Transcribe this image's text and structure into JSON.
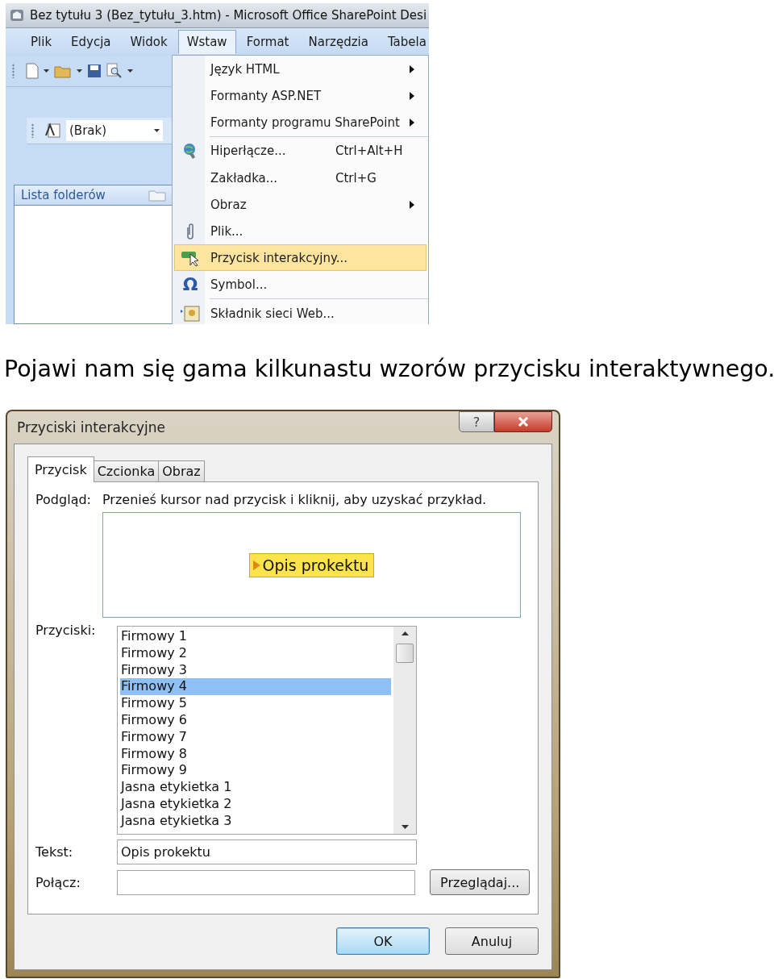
{
  "editor_window": {
    "title": "Bez tytułu 3 (Bez_tytułu_3.htm) - Microsoft Office SharePoint Desi",
    "menu_bar": [
      {
        "label": "Plik",
        "selected": false
      },
      {
        "label": "Edycja",
        "selected": false
      },
      {
        "label": "Widok",
        "selected": false
      },
      {
        "label": "Wstaw",
        "selected": true
      },
      {
        "label": "Format",
        "selected": false
      },
      {
        "label": "Narzędzia",
        "selected": false
      },
      {
        "label": "Tabela",
        "selected": false
      }
    ],
    "style_dropdown": {
      "value": "(Brak)"
    },
    "folder_list": {
      "title": "Lista folderów"
    },
    "insert_menu": [
      {
        "kind": "item",
        "label": "Język HTML",
        "submenu": true,
        "selected": false
      },
      {
        "kind": "item",
        "label": "Formanty ASP.NET",
        "submenu": true,
        "selected": false
      },
      {
        "kind": "item",
        "label": "Formanty programu SharePoint",
        "submenu": true,
        "selected": false
      },
      {
        "kind": "separator"
      },
      {
        "kind": "item",
        "label": "Hiperłącze...",
        "shortcut": "Ctrl+Alt+H",
        "submenu": false,
        "selected": false
      },
      {
        "kind": "item",
        "label": "Zakładka...",
        "shortcut": "Ctrl+G",
        "submenu": false,
        "selected": false
      },
      {
        "kind": "item",
        "label": "Obraz",
        "submenu": true,
        "selected": false
      },
      {
        "kind": "item",
        "label": "Plik...",
        "submenu": false,
        "selected": false
      },
      {
        "kind": "item",
        "label": "Przycisk interakcyjny...",
        "submenu": false,
        "selected": true
      },
      {
        "kind": "item",
        "label": "Symbol...",
        "icon_text": "Ω",
        "submenu": false,
        "selected": false
      },
      {
        "kind": "separator"
      },
      {
        "kind": "item",
        "label": "Składnik sieci Web...",
        "submenu": false,
        "selected": false
      }
    ]
  },
  "caption": "Pojawi nam się gama kilkunastu wzorów przycisku interaktywnego.",
  "dialog": {
    "title": "Przyciski interakcyjne",
    "help_button": "?",
    "tabs": [
      {
        "label": "Przycisk",
        "selected": true
      },
      {
        "label": "Czcionka",
        "selected": false
      },
      {
        "label": "Obraz",
        "selected": false
      }
    ],
    "preview_label": "Podgląd:",
    "preview_hint": "Przenieś kursor nad przycisk i kliknij, aby uzyskać przykład.",
    "preview_button": "Opis prokektu",
    "buttons_label": "Przyciski:",
    "buttons_list": [
      {
        "label": "Firmowy 1",
        "selected": false
      },
      {
        "label": "Firmowy 2",
        "selected": false
      },
      {
        "label": "Firmowy 3",
        "selected": false
      },
      {
        "label": "Firmowy 4",
        "selected": true
      },
      {
        "label": "Firmowy 5",
        "selected": false
      },
      {
        "label": "Firmowy 6",
        "selected": false
      },
      {
        "label": "Firmowy 7",
        "selected": false
      },
      {
        "label": "Firmowy 8",
        "selected": false
      },
      {
        "label": "Firmowy 9",
        "selected": false
      },
      {
        "label": "Jasna etykietka 1",
        "selected": false
      },
      {
        "label": "Jasna etykietka 2",
        "selected": false
      },
      {
        "label": "Jasna etykietka 3",
        "selected": false
      }
    ],
    "text_label": "Tekst:",
    "text_value": "Opis prokektu",
    "link_label": "Połącz:",
    "browse_button": "Przeglądaj...",
    "ok_button": "OK",
    "cancel_button": "Anuluj"
  }
}
